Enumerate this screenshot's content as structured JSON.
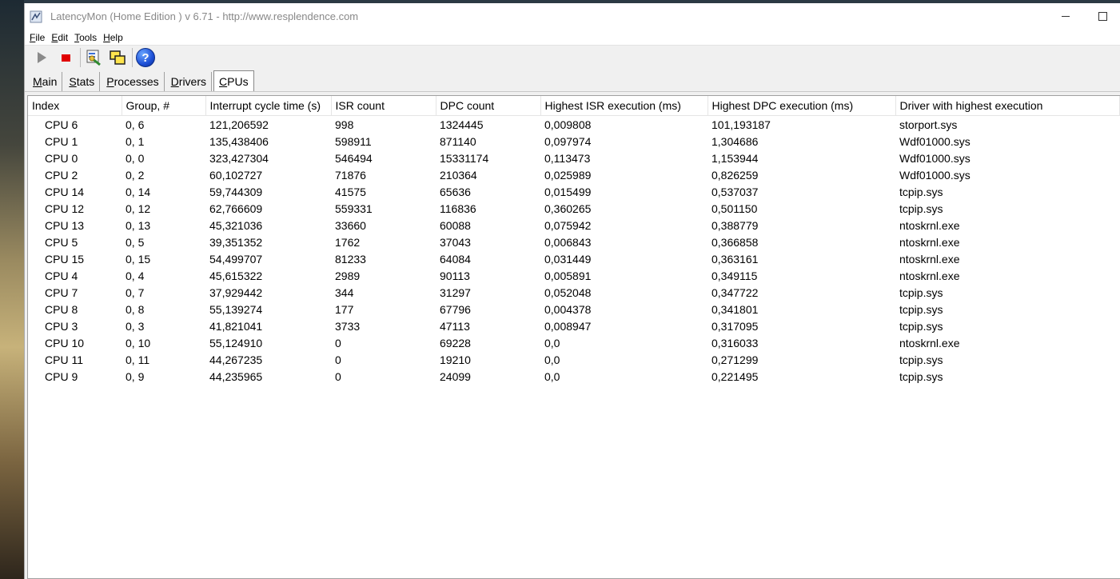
{
  "window": {
    "title": "LatencyMon  (Home Edition )  v 6.71 - http://www.resplendence.com"
  },
  "menu": [
    "File",
    "Edit",
    "Tools",
    "Help"
  ],
  "toolbar": {
    "icons": [
      "play-icon",
      "stop-icon",
      "report-icon",
      "windows-icon",
      "help-icon"
    ],
    "help_glyph": "?"
  },
  "tabs": [
    "Main",
    "Stats",
    "Processes",
    "Drivers",
    "CPUs"
  ],
  "active_tab": "CPUs",
  "table": {
    "columns": [
      "Index",
      "Group, #",
      "Interrupt cycle time (s)",
      "ISR count",
      "DPC count",
      "Highest ISR execution (ms)",
      "Highest DPC execution (ms)",
      "Driver with highest execution"
    ],
    "rows": [
      [
        "CPU 6",
        "0, 6",
        "121,206592",
        "998",
        "1324445",
        "0,009808",
        "101,193187",
        "storport.sys"
      ],
      [
        "CPU 1",
        "0, 1",
        "135,438406",
        "598911",
        "871140",
        "0,097974",
        "1,304686",
        "Wdf01000.sys"
      ],
      [
        "CPU 0",
        "0, 0",
        "323,427304",
        "546494",
        "15331174",
        "0,113473",
        "1,153944",
        "Wdf01000.sys"
      ],
      [
        "CPU 2",
        "0, 2",
        "60,102727",
        "71876",
        "210364",
        "0,025989",
        "0,826259",
        "Wdf01000.sys"
      ],
      [
        "CPU 14",
        "0, 14",
        "59,744309",
        "41575",
        "65636",
        "0,015499",
        "0,537037",
        "tcpip.sys"
      ],
      [
        "CPU 12",
        "0, 12",
        "62,766609",
        "559331",
        "116836",
        "0,360265",
        "0,501150",
        "tcpip.sys"
      ],
      [
        "CPU 13",
        "0, 13",
        "45,321036",
        "33660",
        "60088",
        "0,075942",
        "0,388779",
        "ntoskrnl.exe"
      ],
      [
        "CPU 5",
        "0, 5",
        "39,351352",
        "1762",
        "37043",
        "0,006843",
        "0,366858",
        "ntoskrnl.exe"
      ],
      [
        "CPU 15",
        "0, 15",
        "54,499707",
        "81233",
        "64084",
        "0,031449",
        "0,363161",
        "ntoskrnl.exe"
      ],
      [
        "CPU 4",
        "0, 4",
        "45,615322",
        "2989",
        "90113",
        "0,005891",
        "0,349115",
        "ntoskrnl.exe"
      ],
      [
        "CPU 7",
        "0, 7",
        "37,929442",
        "344",
        "31297",
        "0,052048",
        "0,347722",
        "tcpip.sys"
      ],
      [
        "CPU 8",
        "0, 8",
        "55,139274",
        "177",
        "67796",
        "0,004378",
        "0,341801",
        "tcpip.sys"
      ],
      [
        "CPU 3",
        "0, 3",
        "41,821041",
        "3733",
        "47113",
        "0,008947",
        "0,317095",
        "tcpip.sys"
      ],
      [
        "CPU 10",
        "0, 10",
        "55,124910",
        "0",
        "69228",
        "0,0",
        "0,316033",
        "ntoskrnl.exe"
      ],
      [
        "CPU 11",
        "0, 11",
        "44,267235",
        "0",
        "19210",
        "0,0",
        "0,271299",
        "tcpip.sys"
      ],
      [
        "CPU 9",
        "0, 9",
        "44,235965",
        "0",
        "24099",
        "0,0",
        "0,221495",
        "tcpip.sys"
      ]
    ]
  }
}
